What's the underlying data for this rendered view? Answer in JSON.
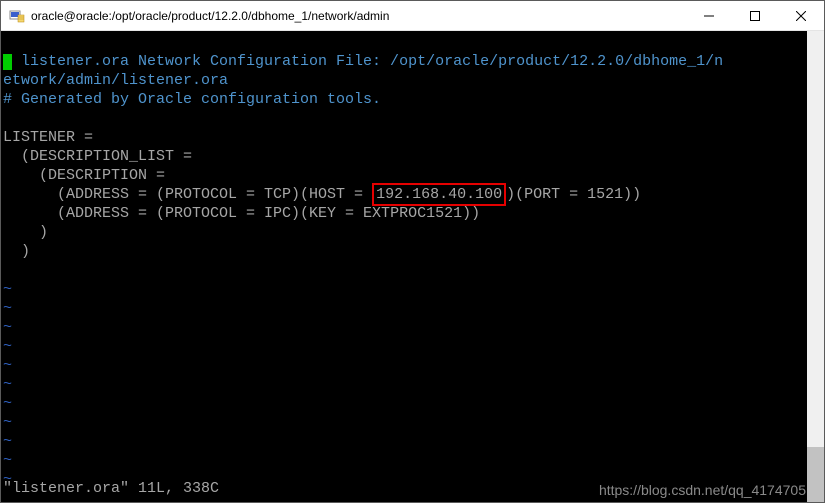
{
  "window": {
    "title": "oracle@oracle:/opt/oracle/product/12.2.0/dbhome_1/network/admin"
  },
  "terminal": {
    "comment_line1": " listener.ora Network Configuration File: /opt/oracle/product/12.2.0/dbhome_1/n",
    "comment_line2": "etwork/admin/listener.ora",
    "comment_line3": "# Generated by Oracle configuration tools.",
    "config_line1": "LISTENER =",
    "config_line2": "  (DESCRIPTION_LIST =",
    "config_line3": "    (DESCRIPTION =",
    "addr1_pre": "      (ADDRESS = (PROTOCOL = TCP)(HOST = ",
    "addr1_highlight": "192.168.40.100",
    "addr1_post": ")(PORT = 1521))",
    "addr2": "      (ADDRESS = (PROTOCOL = IPC)(KEY = EXTPROC1521))",
    "close1": "    )",
    "close2": "  )",
    "tilde": "~",
    "status": "\"listener.ora\" 11L, 338C"
  },
  "watermark": "https://blog.csdn.net/qq_4174705"
}
